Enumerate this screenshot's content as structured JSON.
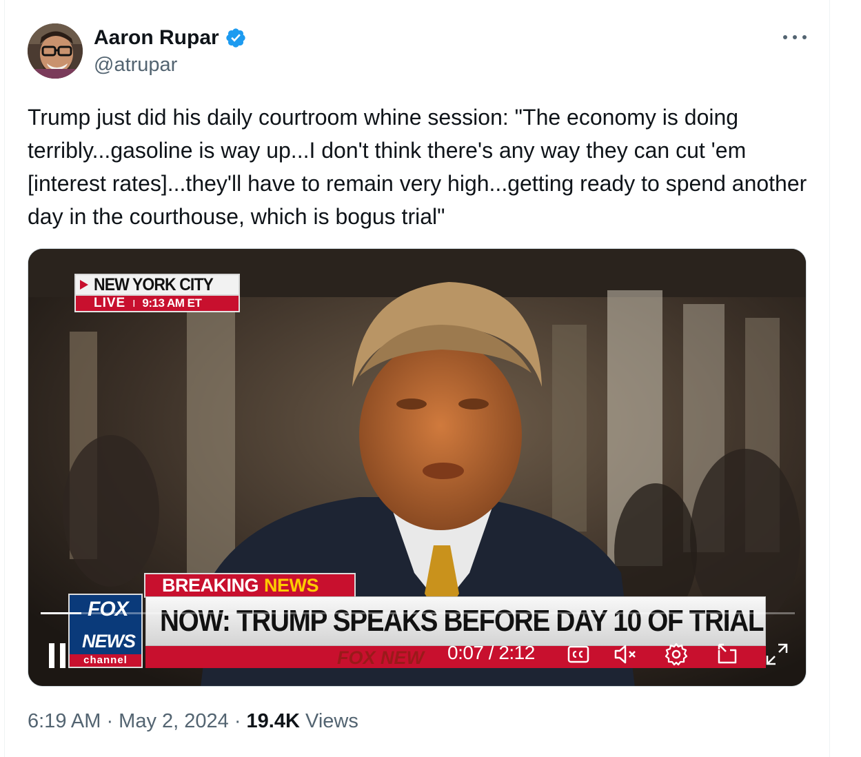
{
  "author": {
    "display_name": "Aaron Rupar",
    "handle": "@atrupar",
    "verified": true,
    "verified_color": "#1d9bf0"
  },
  "tweet": {
    "text": "Trump just did his daily courtroom whine session: \"The economy is doing terribly...gasoline is way up...I don't think there's any way they can cut 'em [interest rates]...they'll have to remain very high...getting ready to spend another day in the courthouse, which is bogus trial\"",
    "timestamp": "6:19 AM · May 2, 2024 · ",
    "views_count": "19.4K",
    "views_label": " Views"
  },
  "video": {
    "location_label": "NEW YORK CITY",
    "live_label": "LIVE",
    "live_separator": "I",
    "live_time": "9:13 AM ET",
    "breaking_a": "BREAKING",
    "breaking_b": "NEWS",
    "network_fox": "FOX",
    "network_news": "NEWS",
    "network_channel": "channel",
    "headline": "NOW: TRUMP SPEAKS BEFORE DAY 10 OF TRIAL",
    "ticker": "FOX NEW",
    "timecode": "0:07 / 2:12",
    "progress": 0.054,
    "muted": true
  },
  "icons": {
    "more": "more-horizontal-icon",
    "verified": "verified-badge-icon",
    "pause": "pause-icon",
    "captions": "captions-icon",
    "mute": "volume-muted-icon",
    "settings": "settings-gear-icon",
    "pip": "picture-in-picture-icon",
    "fullscreen": "fullscreen-icon"
  }
}
